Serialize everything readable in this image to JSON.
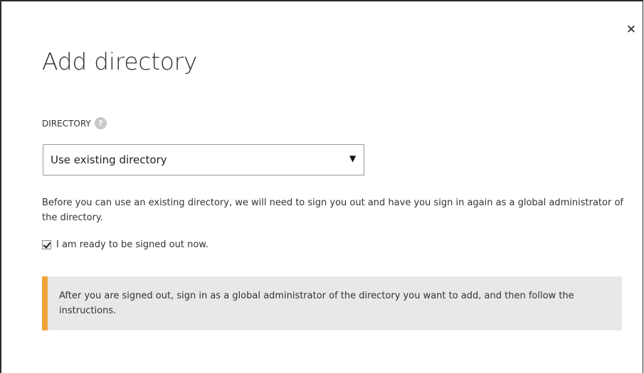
{
  "dialog": {
    "close_label": "×",
    "title": "Add directory"
  },
  "directory_field": {
    "label": "DIRECTORY",
    "help_icon": "question-mark-icon",
    "help_glyph": "?",
    "selected_value": "Use existing directory",
    "arrow_glyph": "▼"
  },
  "info": {
    "text": "Before you can use an existing directory, we will need to sign you out and have you sign in again as a global administrator of the directory."
  },
  "confirm": {
    "checked": true,
    "label": "I am ready to be signed out now."
  },
  "notice": {
    "text": "After you are signed out, sign in as a global administrator of the directory you want to add, and then follow the instructions.",
    "accent_color": "#f0a23a",
    "background_color": "#e8e8e8"
  }
}
